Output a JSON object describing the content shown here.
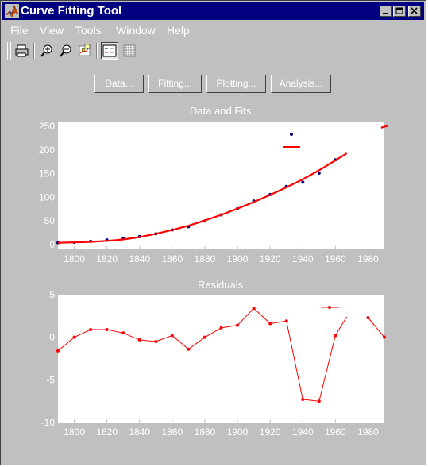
{
  "window": {
    "title": "Curve Fitting Tool"
  },
  "menu": {
    "items": [
      "File",
      "View",
      "Tools",
      "Window",
      "Help"
    ]
  },
  "toolbar": {
    "icons": [
      "print-icon",
      "zoom-in-icon",
      "zoom-out-icon",
      "data-cursor-icon",
      "legend-icon",
      "grid-icon"
    ]
  },
  "buttons": {
    "data": "Data...",
    "fitting": "Fitting...",
    "plotting": "Plotting...",
    "analysis": "Analysis..."
  },
  "colors": {
    "accent": "#ff0000",
    "titlebar": "#000080",
    "face": "#c0c0c0",
    "data_points": "#000080"
  },
  "chart_data": [
    {
      "type": "scatter",
      "title": "Data and Fits",
      "xlabel": "",
      "ylabel": "",
      "xlim": [
        1790,
        1990
      ],
      "ylim": [
        -10,
        260
      ],
      "xticks": [
        1800,
        1820,
        1840,
        1860,
        1880,
        1900,
        1920,
        1940,
        1960,
        1980
      ],
      "yticks": [
        0,
        50,
        100,
        150,
        200,
        250
      ],
      "grid": false,
      "legend": "top-right",
      "series": [
        {
          "kind": "points",
          "color": "#000080",
          "x": [
            1790,
            1800,
            1810,
            1820,
            1830,
            1840,
            1850,
            1860,
            1870,
            1880,
            1890,
            1900,
            1910,
            1920,
            1930,
            1940,
            1950,
            1960
          ],
          "y": [
            4,
            5,
            7,
            10,
            13,
            17,
            23,
            31,
            38,
            50,
            63,
            76,
            92,
            106,
            123,
            132,
            151,
            179
          ]
        },
        {
          "kind": "fit",
          "color": "#ff0000",
          "x": [
            1790,
            1800,
            1810,
            1820,
            1830,
            1840,
            1850,
            1860,
            1870,
            1880,
            1890,
            1900,
            1910,
            1920,
            1930,
            1940,
            1950,
            1960,
            1967
          ],
          "y": [
            4,
            5,
            6,
            8,
            11,
            16,
            23,
            31,
            40,
            51,
            63,
            76,
            90,
            105,
            121,
            138,
            157,
            178,
            193
          ]
        },
        {
          "kind": "fit",
          "color": "#ff0000",
          "x": [
            1988,
            1992
          ],
          "y": [
            247,
            251
          ]
        }
      ]
    },
    {
      "type": "line",
      "title": "Residuals",
      "xlabel": "",
      "ylabel": "",
      "xlim": [
        1790,
        1990
      ],
      "ylim": [
        -10,
        5
      ],
      "xticks": [
        1800,
        1820,
        1840,
        1860,
        1880,
        1900,
        1920,
        1940,
        1960,
        1980
      ],
      "yticks": [
        5,
        0,
        -5,
        -10
      ],
      "grid": false,
      "legend": "top-right",
      "series": [
        {
          "color": "#ff0000",
          "markers": true,
          "x": [
            1790,
            1800,
            1810,
            1820,
            1830,
            1840,
            1850,
            1860,
            1870,
            1880,
            1890,
            1900,
            1910,
            1920,
            1930,
            1940,
            1950,
            1960,
            1967
          ],
          "y": [
            -1.6,
            0.0,
            0.9,
            0.9,
            0.5,
            -0.3,
            -0.5,
            0.2,
            -1.4,
            0.0,
            1.1,
            1.4,
            3.4,
            1.6,
            1.9,
            -7.3,
            -7.5,
            0.2,
            2.4
          ]
        },
        {
          "color": "#ff0000",
          "markers": true,
          "x": [
            1980,
            1990
          ],
          "y": [
            2.3,
            0.0
          ]
        }
      ]
    }
  ]
}
